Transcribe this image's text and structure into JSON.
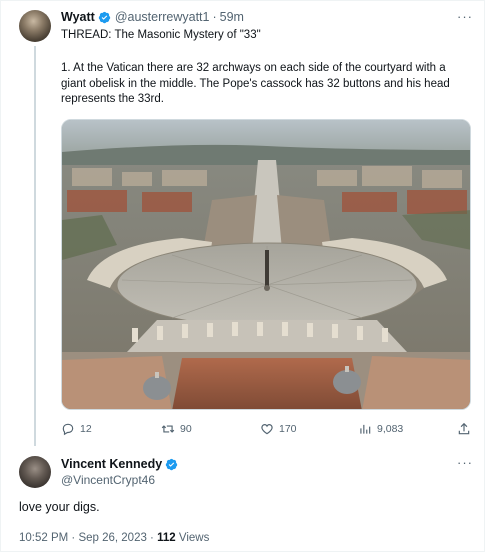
{
  "tweet1": {
    "author_name": "Wyatt",
    "handle": "@austerrewyatt1",
    "separator": "·",
    "time": "59m",
    "title": "THREAD: The Masonic Mystery of \"33\"",
    "body": "1. At the Vatican there are 32 archways on each side of the courtyard with a giant obelisk in the middle. The Pope's cassock has 32 buttons and his head represents the 33rd.",
    "image_subject": "St. Peter's Square aerial view",
    "actions": {
      "replies": "12",
      "retweets": "90",
      "likes": "170",
      "views": "9,083"
    }
  },
  "tweet2": {
    "author_name": "Vincent Kennedy",
    "handle": "@VincentCrypt46",
    "text": "love your digs.",
    "timestamp": "10:52 PM · Sep 26, 2023 ·",
    "views_count": "112",
    "views_label": "Views"
  },
  "more_symbol": "···",
  "colors": {
    "verified": "#1d9bf0",
    "text": "#0f1419",
    "secondary": "#536471",
    "border": "#cfd9de"
  }
}
